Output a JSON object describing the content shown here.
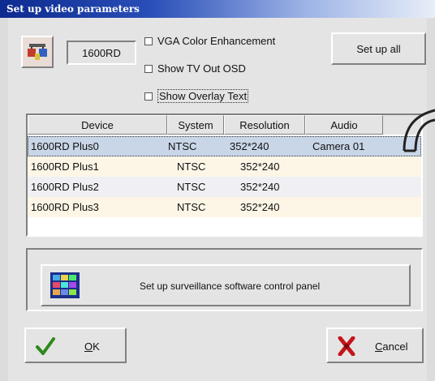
{
  "window": {
    "title": "Set up video parameters"
  },
  "device": {
    "name": "1600RD"
  },
  "options": {
    "vga_color": "VGA Color Enhancement",
    "tv_out_osd": "Show TV Out OSD",
    "overlay_text": "Show Overlay Text"
  },
  "buttons": {
    "setup_all": "Set up all",
    "surveillance": "Set up surveillance software control panel",
    "ok": "OK",
    "cancel": "Cancel"
  },
  "table": {
    "columns": [
      "Device",
      "System",
      "Resolution",
      "Audio"
    ],
    "rows": [
      {
        "device": "1600RD Plus0",
        "system": "NTSC",
        "resolution": "352*240",
        "audio": "Camera 01"
      },
      {
        "device": "1600RD Plus1",
        "system": "NTSC",
        "resolution": "352*240",
        "audio": ""
      },
      {
        "device": "1600RD Plus2",
        "system": "NTSC",
        "resolution": "352*240",
        "audio": ""
      },
      {
        "device": "1600RD Plus3",
        "system": "NTSC",
        "resolution": "352*240",
        "audio": ""
      }
    ]
  },
  "icons": {
    "device": "device-settings-icon",
    "surveillance": "monitor-grid-icon",
    "ok": "green-check-icon",
    "cancel": "red-x-icon"
  },
  "colors": {
    "title_bar": "#0d2a8f",
    "selected_row": "#c9d6e8",
    "ok_check": "#2d8a1a",
    "cancel_x": "#c4141b"
  }
}
